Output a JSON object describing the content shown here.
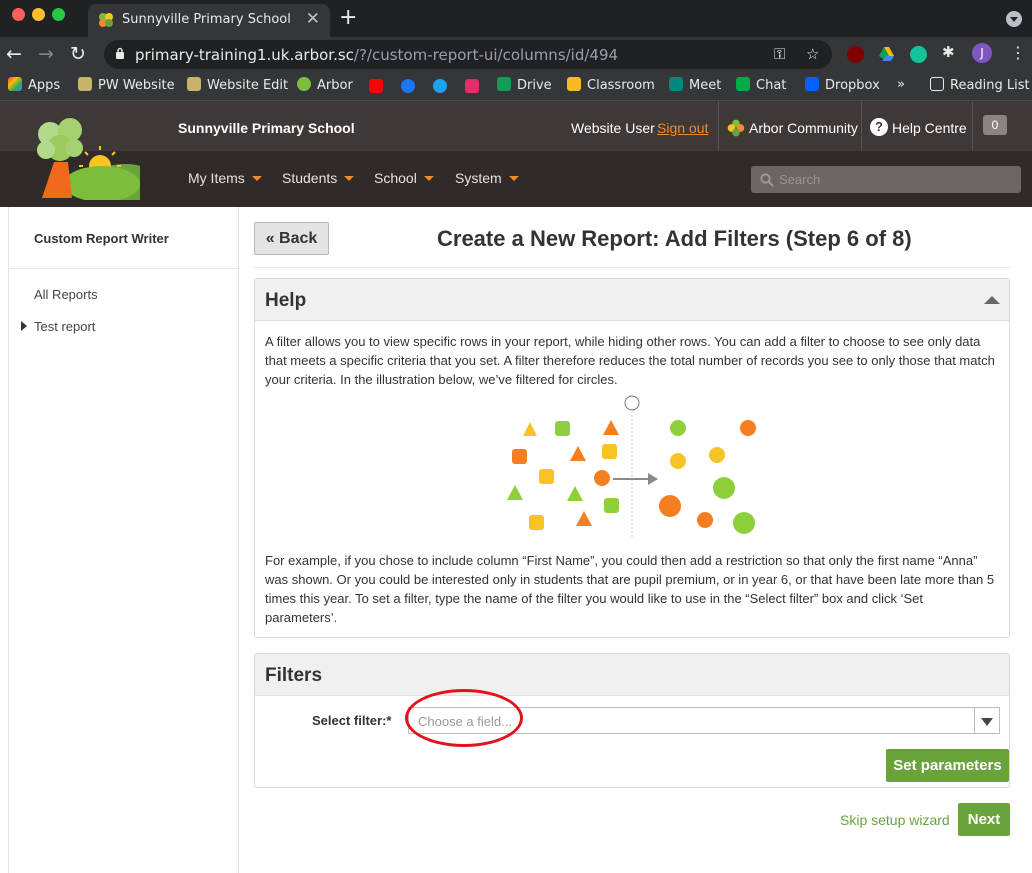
{
  "browser": {
    "tab_title": "Sunnyville Primary School",
    "url_host": "primary-training1.uk.arbor.sc",
    "url_path": "/?/custom-report-ui/columns/id/494",
    "profile_initial": "J",
    "bookmarks": [
      "Apps",
      "PW Website",
      "Website Edit",
      "Arbor",
      "Drive",
      "Classroom",
      "Meet",
      "Chat",
      "Dropbox",
      "Reading List"
    ],
    "overflow": "»"
  },
  "header": {
    "school_name": "Sunnyville Primary School",
    "user_name": "Website User",
    "sign_out": "Sign out",
    "community": "Arbor Community",
    "help_centre": "Help Centre",
    "notifications": "0",
    "menu": [
      "My Items",
      "Students",
      "School",
      "System"
    ],
    "search_placeholder": "Search"
  },
  "sidebar": {
    "title": "Custom Report Writer",
    "links": [
      "All Reports",
      "Test report"
    ]
  },
  "main": {
    "back_label": "« Back",
    "title": "Create a New Report: Add Filters (Step 6 of 8)",
    "help": {
      "heading": "Help",
      "paragraph1": "A filter allows you to view specific rows in your report, while hiding other rows. You can add a filter to choose to see only data that meets a specific criteria that you set. A filter therefore reduces the total number of records you see to only those that match your criteria. In the illustration below, we’ve filtered for circles.",
      "paragraph2": "For example, if you chose to include column “First Name”, you could then add a restriction so that only the first name “Anna” was shown. Or you could be interested only in students that are pupil premium, or in year 6, or that have been late more than 5 times this year. To set a filter, type the name of the filter you would like to use in the “Select filter” box and click ‘Set parameters’."
    },
    "filters": {
      "heading": "Filters",
      "select_label": "Select filter:*",
      "select_placeholder": "Choose a field...",
      "set_params": "Set parameters"
    },
    "skip_label": "Skip setup wizard",
    "next_label": "Next"
  },
  "colors": {
    "arbor_green": "#6aa33b",
    "arbor_orange": "#ef8a2d",
    "highlight_red": "#e3121b"
  }
}
